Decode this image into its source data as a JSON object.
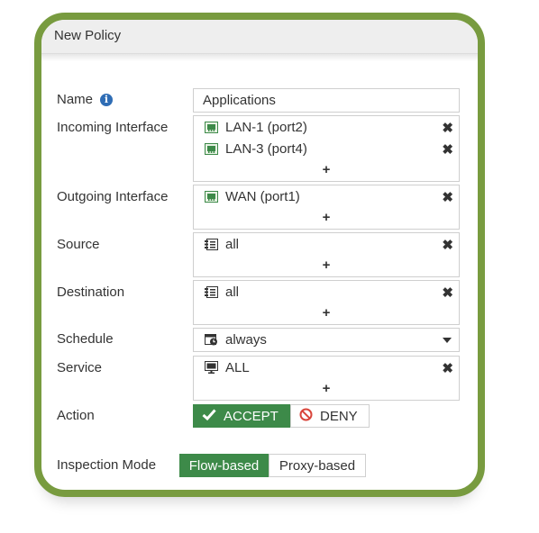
{
  "window": {
    "title": "New Policy"
  },
  "colors": {
    "frame": "#789b3f",
    "accent": "#3d8a49",
    "info": "#2f6db5",
    "deny": "#d9463c"
  },
  "form": {
    "name": {
      "label": "Name",
      "value": "Applications",
      "icon": "info-icon"
    },
    "incoming": {
      "label": "Incoming Interface",
      "items": [
        {
          "text": "LAN-1 (port2)",
          "icon": "port-icon"
        },
        {
          "text": "LAN-3 (port4)",
          "icon": "port-icon"
        }
      ]
    },
    "outgoing": {
      "label": "Outgoing Interface",
      "items": [
        {
          "text": "WAN (port1)",
          "icon": "port-icon"
        }
      ]
    },
    "source": {
      "label": "Source",
      "items": [
        {
          "text": "all",
          "icon": "address-icon"
        }
      ]
    },
    "destination": {
      "label": "Destination",
      "items": [
        {
          "text": "all",
          "icon": "address-icon"
        }
      ]
    },
    "schedule": {
      "label": "Schedule",
      "value": "always",
      "icon": "schedule-icon"
    },
    "service": {
      "label": "Service",
      "items": [
        {
          "text": "ALL",
          "icon": "service-icon"
        }
      ]
    },
    "add_glyph": "+",
    "remove_glyph": "✖",
    "action": {
      "label": "Action",
      "options": [
        {
          "text": "ACCEPT",
          "icon": "check-icon",
          "selected": true
        },
        {
          "text": "DENY",
          "icon": "deny-icon",
          "selected": false
        }
      ]
    },
    "inspection_mode": {
      "label": "Inspection Mode",
      "options": [
        {
          "text": "Flow-based",
          "selected": true
        },
        {
          "text": "Proxy-based",
          "selected": false
        }
      ]
    }
  }
}
